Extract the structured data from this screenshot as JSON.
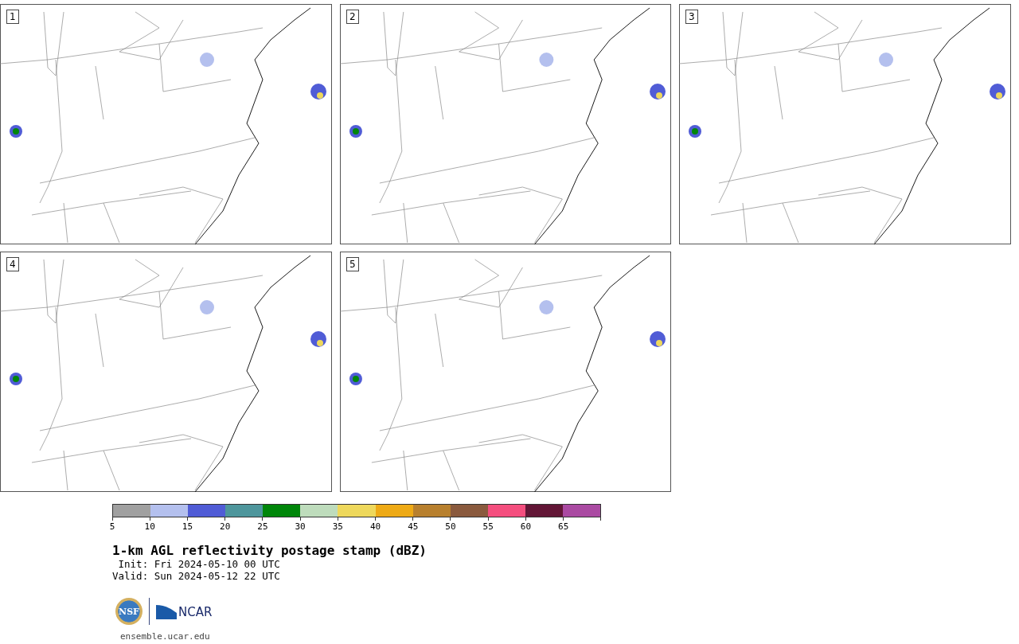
{
  "panels": [
    {
      "label": "1"
    },
    {
      "label": "2"
    },
    {
      "label": "3"
    },
    {
      "label": "4"
    },
    {
      "label": "5"
    }
  ],
  "colorbar": {
    "segments": [
      {
        "color": "#a0a0a0",
        "tick": "5"
      },
      {
        "color": "#b4c0ee",
        "tick": "10"
      },
      {
        "color": "#505cd6",
        "tick": "15"
      },
      {
        "color": "#4e969c",
        "tick": "20"
      },
      {
        "color": "#00860a",
        "tick": "25"
      },
      {
        "color": "#bedcbc",
        "tick": "30"
      },
      {
        "color": "#eed85c",
        "tick": "35"
      },
      {
        "color": "#eeaa16",
        "tick": "40"
      },
      {
        "color": "#b8802e",
        "tick": "45"
      },
      {
        "color": "#8a5a3e",
        "tick": "50"
      },
      {
        "color": "#f44e7e",
        "tick": "55"
      },
      {
        "color": "#621636",
        "tick": "60"
      },
      {
        "color": "#aa4aa2",
        "tick": "65"
      }
    ]
  },
  "title": "1-km AGL reflectivity postage stamp (dBZ)",
  "init": " Init: Fri 2024-05-10 00 UTC",
  "valid": "Valid: Sun 2024-05-12 22 UTC",
  "logo": {
    "seal": "NSF",
    "name": "NCAR"
  },
  "url": "ensemble.ucar.edu"
}
